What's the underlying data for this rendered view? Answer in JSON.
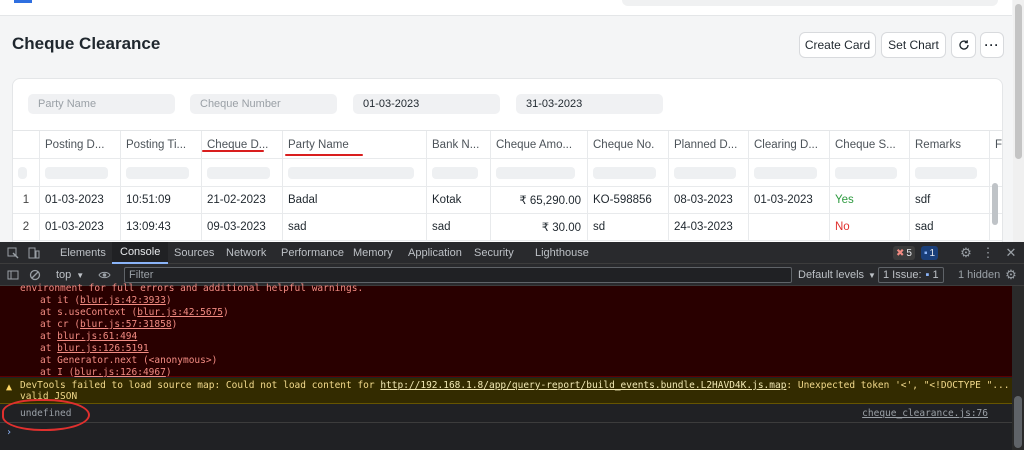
{
  "page": {
    "title": "Cheque Clearance",
    "actions": [
      "Create Card",
      "Set Chart"
    ]
  },
  "filters": {
    "party_name_placeholder": "Party Name",
    "cheque_number_placeholder": "Cheque Number",
    "from_date": "01-03-2023",
    "to_date": "31-03-2023"
  },
  "table": {
    "columns": [
      "Posting D...",
      "Posting Ti...",
      "Cheque D...",
      "Party Name",
      "Bank N...",
      "Cheque Amo...",
      "Cheque No.",
      "Planned D...",
      "Clearing D...",
      "Cheque S...",
      "Remarks",
      "F"
    ],
    "rows": [
      [
        "1",
        "01-03-2023",
        "10:51:09",
        "21-02-2023",
        "Badal",
        "Kotak",
        "₹ 65,290.00",
        "KO-598856",
        "08-03-2023",
        "01-03-2023",
        "Yes",
        "sdf"
      ],
      [
        "2",
        "01-03-2023",
        "13:09:43",
        "09-03-2023",
        "sad",
        "sad",
        "₹ 30.00",
        "sd",
        "24-03-2023",
        "",
        "No",
        "sad"
      ]
    ],
    "status_colors": {
      "Yes": "#2d9a3f",
      "No": "#e0302e"
    }
  },
  "devtools": {
    "tabs": [
      "Elements",
      "Console",
      "Sources",
      "Network",
      "Performance",
      "Memory",
      "Application",
      "Security",
      "Lighthouse"
    ],
    "active_tab": "Console",
    "error_count": "5",
    "message_count": "1",
    "context": "top",
    "filter_placeholder": "Filter",
    "levels_label": "Default levels",
    "issues_label": "1 Issue:",
    "issues_count": "1",
    "hidden_label": "1 hidden",
    "error_lines": [
      "environment for full errors and additional helpful warnings."
    ],
    "stack": [
      {
        "prefix": "at it (",
        "link": "blur.js:42:3933",
        "suffix": ")"
      },
      {
        "prefix": "at s.useContext (",
        "link": "blur.js:42:5675",
        "suffix": ")"
      },
      {
        "prefix": "at cr (",
        "link": "blur.js:57:31858",
        "suffix": ")"
      },
      {
        "prefix": "at ",
        "link": "blur.js:61:494",
        "suffix": ""
      },
      {
        "prefix": "at ",
        "link": "blur.js:126:5191",
        "suffix": ""
      },
      {
        "prefix": "at Generator.next (<anonymous>)",
        "link": "",
        "suffix": ""
      },
      {
        "prefix": "at I (",
        "link": "blur.js:126:4967",
        "suffix": ")"
      }
    ],
    "warning": {
      "prefix": "DevTools failed to load source map: Could not load content for ",
      "link": "http://192.168.1.8/app/query-report/build_events.bundle.L2HAVD4K.js.map",
      "suffix": ": Unexpected token '<', \"<!DOCTYPE \"... is not",
      "line2": "valid JSON"
    },
    "output": "undefined",
    "output_source": "cheque_clearance.js:76"
  }
}
